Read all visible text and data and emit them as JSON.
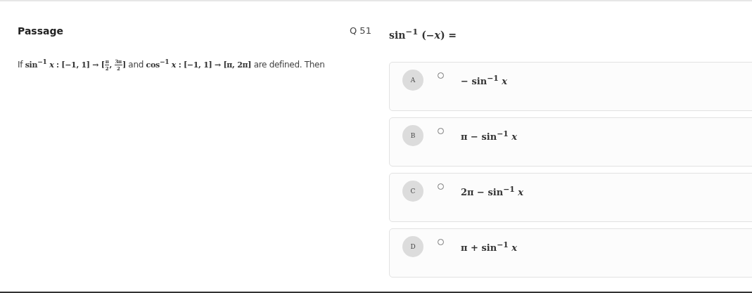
{
  "passage": {
    "title": "Passage",
    "segments": [
      {
        "kind": "text",
        "text": "If "
      },
      {
        "kind": "math",
        "text": "sin$^{−1}$ *x* : [−1, 1] → ["
      },
      {
        "kind": "fraction",
        "num": "π",
        "den": "2"
      },
      {
        "kind": "math",
        "text": ", "
      },
      {
        "kind": "fraction",
        "num": "3π",
        "den": "2"
      },
      {
        "kind": "math",
        "text": "]"
      },
      {
        "kind": "text",
        "text": " and "
      },
      {
        "kind": "math",
        "text": "cos$^{−1}$ *x* : [−1, 1] → [π, 2π]"
      },
      {
        "kind": "text",
        "text": " are defined. Then"
      }
    ]
  },
  "question": {
    "number": "Q 51",
    "text": "sin$^{−1}$ (−*x*) ="
  },
  "options": [
    {
      "letter": "A",
      "text": "− sin$^{−1}$ *x*",
      "selected": false
    },
    {
      "letter": "B",
      "text": "π − sin$^{−1}$ *x*",
      "selected": false
    },
    {
      "letter": "C",
      "text": "2π − sin$^{−1}$ *x*",
      "selected": false
    },
    {
      "letter": "D",
      "text": "π + sin$^{−1}$ *x*",
      "selected": false
    }
  ]
}
